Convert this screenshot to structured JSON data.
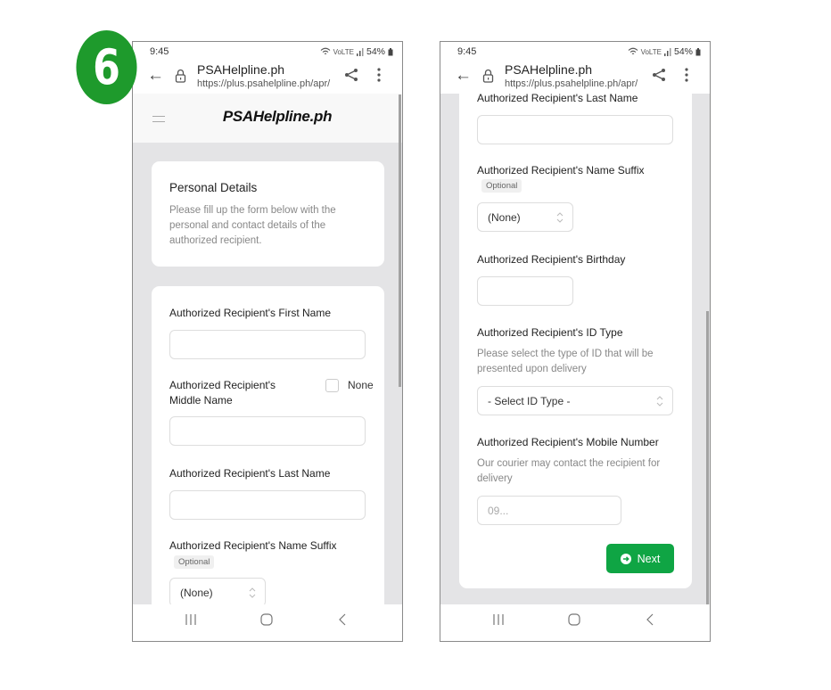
{
  "step": {
    "number": "6"
  },
  "colors": {
    "step_badge": "#1e9a2c",
    "next_button": "#0fa544",
    "page_bg": "#e4e4e6"
  },
  "status_bar": {
    "time": "9:45",
    "battery": "54%",
    "network": "VoLTE"
  },
  "browser": {
    "site_title": "PSAHelpline.ph",
    "url": "https://plus.psahelpline.ph/apr/",
    "back_icon": "arrow-left-icon",
    "lock_icon": "lock-icon",
    "share_icon": "share-icon",
    "menu_icon": "kebab-menu-icon"
  },
  "site": {
    "logo": "PSAHelpline.ph"
  },
  "intro_card": {
    "title": "Personal Details",
    "description": "Please fill up the form below with the personal and contact details of the authorized recipient."
  },
  "form": {
    "first_name": {
      "label": "Authorized Recipient's First Name",
      "value": ""
    },
    "middle_name": {
      "label": "Authorized Recipient's Middle Name",
      "value": "",
      "none_label": "None",
      "none_checked": false
    },
    "last_name": {
      "label": "Authorized Recipient's Last Name",
      "value": ""
    },
    "name_suffix": {
      "label": "Authorized Recipient's Name Suffix",
      "badge": "Optional",
      "selected": "(None)"
    },
    "birthday": {
      "label": "Authorized Recipient's Birthday",
      "value": ""
    },
    "id_type": {
      "label": "Authorized Recipient's ID Type",
      "help": "Please select the type of ID that will be presented upon delivery",
      "selected": "- Select ID Type -"
    },
    "mobile": {
      "label": "Authorized Recipient's Mobile Number",
      "help": "Our courier may contact the recipient for delivery",
      "placeholder": "09..."
    },
    "next_button": "Next"
  },
  "nav_bar": {
    "recents_icon": "recents-icon",
    "home_icon": "home-icon",
    "back_icon": "back-chevron-icon"
  }
}
